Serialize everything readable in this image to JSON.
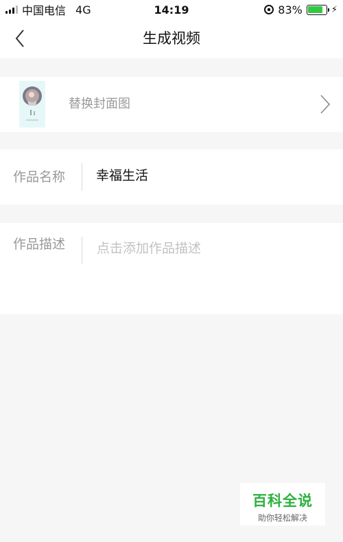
{
  "status_bar": {
    "carrier": "中国电信",
    "network": "4G",
    "time": "14:19",
    "battery_percent": "83%",
    "battery_level": 0.83,
    "battery_color": "#33c843"
  },
  "nav": {
    "title": "生成视频",
    "back_icon": "chevron-left-icon"
  },
  "cover": {
    "label": "替换封面图",
    "chevron_icon": "chevron-right-icon"
  },
  "name_field": {
    "label": "作品名称",
    "value": "幸福生活"
  },
  "desc_field": {
    "label": "作品描述",
    "placeholder": "点击添加作品描述"
  },
  "watermark": {
    "title": "百科全说",
    "subtitle": "助你轻松解决",
    "color": "#2bb13c"
  }
}
